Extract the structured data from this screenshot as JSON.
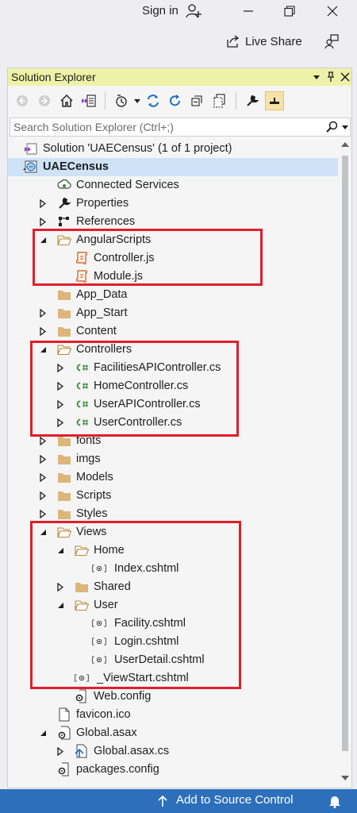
{
  "titlebar": {
    "signin_label": "Sign in",
    "liveshare_label": "Live Share"
  },
  "panel": {
    "title": "Solution Explorer",
    "search_placeholder": "Search Solution Explorer (Ctrl+;)"
  },
  "tree": [
    {
      "label": "Solution 'UAECensus' (1 of 1 project)",
      "icon": "solution-icon",
      "indent": 0,
      "arrow": "none"
    },
    {
      "label": "UAECensus",
      "icon": "web-project-icon",
      "indent": 0,
      "arrow": "expanded",
      "bold": true,
      "selected": true
    },
    {
      "label": "Connected Services",
      "icon": "connected-services-icon",
      "indent": 1,
      "arrow": "none"
    },
    {
      "label": "Properties",
      "icon": "wrench-icon",
      "indent": 1,
      "arrow": "collapsed"
    },
    {
      "label": "References",
      "icon": "references-icon",
      "indent": 1,
      "arrow": "collapsed"
    },
    {
      "label": "AngularScripts",
      "icon": "folder-open-icon",
      "indent": 1,
      "arrow": "expanded"
    },
    {
      "label": "Controller.js",
      "icon": "js-file-icon",
      "indent": 2,
      "arrow": "none"
    },
    {
      "label": "Module.js",
      "icon": "js-file-icon",
      "indent": 2,
      "arrow": "none"
    },
    {
      "label": "App_Data",
      "icon": "folder-icon",
      "indent": 1,
      "arrow": "none"
    },
    {
      "label": "App_Start",
      "icon": "folder-icon",
      "indent": 1,
      "arrow": "collapsed"
    },
    {
      "label": "Content",
      "icon": "folder-icon",
      "indent": 1,
      "arrow": "collapsed"
    },
    {
      "label": "Controllers",
      "icon": "folder-open-icon",
      "indent": 1,
      "arrow": "expanded"
    },
    {
      "label": "FacilitiesAPIController.cs",
      "icon": "csharp-file-icon",
      "indent": 2,
      "arrow": "collapsed"
    },
    {
      "label": "HomeController.cs",
      "icon": "csharp-file-icon",
      "indent": 2,
      "arrow": "collapsed"
    },
    {
      "label": "UserAPIController.cs",
      "icon": "csharp-file-icon",
      "indent": 2,
      "arrow": "collapsed"
    },
    {
      "label": "UserController.cs",
      "icon": "csharp-file-icon",
      "indent": 2,
      "arrow": "collapsed"
    },
    {
      "label": "fonts",
      "icon": "folder-icon",
      "indent": 1,
      "arrow": "collapsed"
    },
    {
      "label": "imgs",
      "icon": "folder-icon",
      "indent": 1,
      "arrow": "collapsed"
    },
    {
      "label": "Models",
      "icon": "folder-icon",
      "indent": 1,
      "arrow": "collapsed"
    },
    {
      "label": "Scripts",
      "icon": "folder-icon",
      "indent": 1,
      "arrow": "collapsed"
    },
    {
      "label": "Styles",
      "icon": "folder-icon",
      "indent": 1,
      "arrow": "collapsed"
    },
    {
      "label": "Views",
      "icon": "folder-open-icon",
      "indent": 1,
      "arrow": "expanded"
    },
    {
      "label": "Home",
      "icon": "folder-open-icon",
      "indent": 2,
      "arrow": "expanded"
    },
    {
      "label": "Index.cshtml",
      "icon": "cshtml-file-icon",
      "indent": 3,
      "arrow": "none"
    },
    {
      "label": "Shared",
      "icon": "folder-icon",
      "indent": 2,
      "arrow": "collapsed"
    },
    {
      "label": "User",
      "icon": "folder-open-icon",
      "indent": 2,
      "arrow": "expanded"
    },
    {
      "label": "Facility.cshtml",
      "icon": "cshtml-file-icon",
      "indent": 3,
      "arrow": "none"
    },
    {
      "label": "Login.cshtml",
      "icon": "cshtml-file-icon",
      "indent": 3,
      "arrow": "none"
    },
    {
      "label": "UserDetail.cshtml",
      "icon": "cshtml-file-icon",
      "indent": 3,
      "arrow": "none"
    },
    {
      "label": "_ViewStart.cshtml",
      "icon": "cshtml-file-icon",
      "indent": 2,
      "arrow": "none"
    },
    {
      "label": "Web.config",
      "icon": "config-file-icon",
      "indent": 2,
      "arrow": "none"
    },
    {
      "label": "favicon.ico",
      "icon": "ico-file-icon",
      "indent": 1,
      "arrow": "none"
    },
    {
      "label": "Global.asax",
      "icon": "asax-file-icon",
      "indent": 1,
      "arrow": "expanded"
    },
    {
      "label": "Global.asax.cs",
      "icon": "csharp-doc-icon",
      "indent": 2,
      "arrow": "collapsed"
    },
    {
      "label": "packages.config",
      "icon": "config-file-icon",
      "indent": 1,
      "arrow": "none"
    }
  ],
  "statusbar": {
    "source_control_label": "Add to Source Control"
  },
  "colors": {
    "accent": "#2d6fba",
    "highlight": "#e01e2d",
    "folder": "#dcb67a",
    "js": "#d86a2c",
    "csharp": "#388a34",
    "title_bar": "#eef2a8"
  }
}
